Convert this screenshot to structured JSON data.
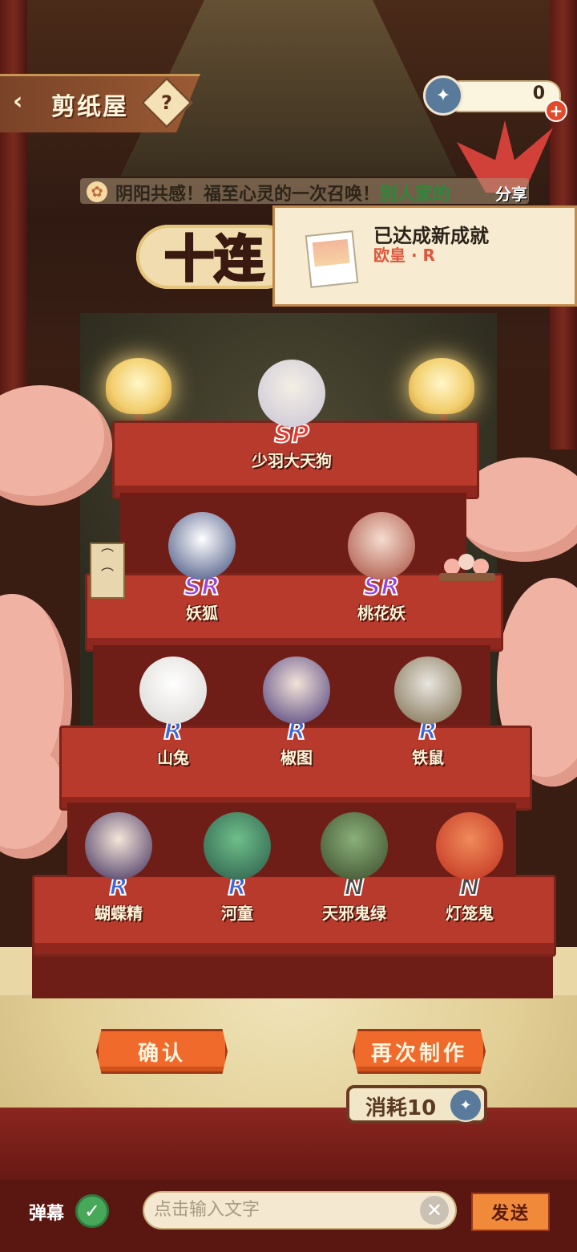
{
  "header": {
    "title": "剪纸屋",
    "help_glyph": "?",
    "currency_value": "0"
  },
  "marquee": {
    "text_prefix": "阴阳共感！福至心灵的一次召唤！",
    "text_highlight": "别人家的"
  },
  "share_label": "分享",
  "ten_label": "十连",
  "achievement": {
    "title": "已达成新成就",
    "subtitle": "欧皇 · R"
  },
  "characters": [
    {
      "name": "少羽大天狗",
      "rarity": "SP"
    },
    {
      "name": "妖狐",
      "rarity": "SR"
    },
    {
      "name": "桃花妖",
      "rarity": "SR"
    },
    {
      "name": "山兔",
      "rarity": "R"
    },
    {
      "name": "椒图",
      "rarity": "R"
    },
    {
      "name": "铁鼠",
      "rarity": "R"
    },
    {
      "name": "蝴蝶精",
      "rarity": "R"
    },
    {
      "name": "河童",
      "rarity": "R"
    },
    {
      "name": "天邪鬼绿",
      "rarity": "N"
    },
    {
      "name": "灯笼鬼",
      "rarity": "N"
    }
  ],
  "buttons": {
    "confirm": "确认",
    "remake": "再次制作",
    "cost": "消耗10"
  },
  "bottom": {
    "danmu_label": "弹幕",
    "input_placeholder": "点击输入文字",
    "send_label": "发送"
  },
  "colors": {
    "accent_orange": "#f06a2c",
    "sp": "#e63a30",
    "sr": "#9a45d8",
    "r": "#3d66d6",
    "n": "#4a4a4a"
  }
}
